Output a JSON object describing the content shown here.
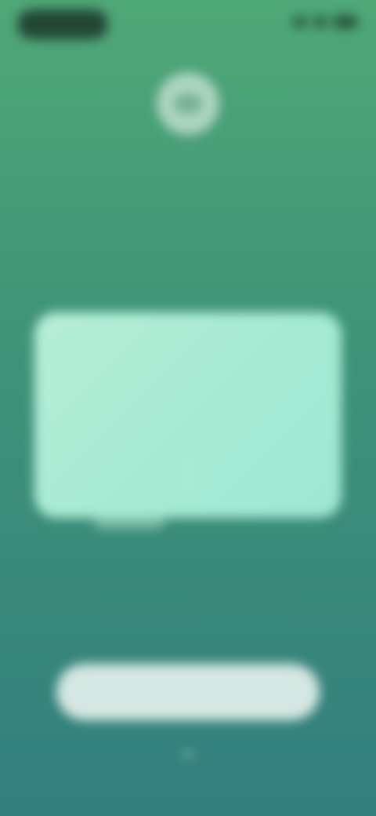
{
  "status_bar": {
    "time": "",
    "icons": [
      "signal-icon",
      "wifi-icon",
      "battery-icon"
    ]
  },
  "hero": {
    "icon": "app-logo-icon",
    "text": ""
  },
  "modal": {
    "title": "",
    "body": "",
    "primary_label": "",
    "secondary_label": ""
  },
  "cta": {
    "label": ""
  },
  "colors": {
    "background_top": "#4fa877",
    "background_bottom": "#327f7e",
    "modal_bg": "#a6ead3",
    "cta_bg": "#ebf5f0"
  }
}
